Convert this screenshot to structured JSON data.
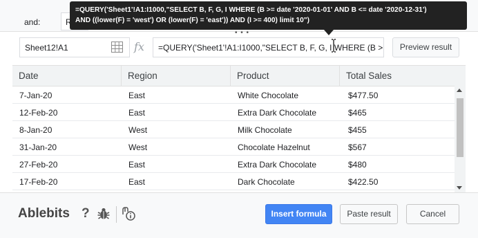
{
  "background_form": {
    "and_label": "and:",
    "field_partial": "R"
  },
  "tooltip": {
    "line1": "=QUERY('Sheet1'!A1:I1000,\"SELECT B, F, G, I WHERE (B >= date '2020-01-01' AND B <= date '2020-12-31')",
    "line2": "AND ((lower(F) = 'west') OR (lower(F) = 'east')) AND (I >= 400) limit 10\")"
  },
  "formula_bar": {
    "range": "Sheet12!A1",
    "fx_symbol": "fx",
    "formula": "=QUERY('Sheet1'!A1:I1000,\"SELECT B, F, G, I WHERE (B >",
    "preview_label": "Preview result"
  },
  "table": {
    "columns": [
      "Date",
      "Region",
      "Product",
      "Total Sales"
    ],
    "rows": [
      [
        "7-Jan-20",
        "East",
        "White Chocolate",
        "$477.50"
      ],
      [
        "12-Feb-20",
        "East",
        "Extra Dark Chocolate",
        "$465"
      ],
      [
        "8-Jan-20",
        "West",
        "Milk Chocolate",
        "$455"
      ],
      [
        "31-Jan-20",
        "West",
        "Chocolate Hazelnut",
        "$567"
      ],
      [
        "27-Feb-20",
        "East",
        "Extra Dark Chocolate",
        "$480"
      ],
      [
        "17-Feb-20",
        "East",
        "Dark Chocolate",
        "$422.50"
      ]
    ]
  },
  "footer": {
    "brand": "Ablebits",
    "help_symbol": "?",
    "insert_label": "Insert formula",
    "paste_label": "Paste result",
    "cancel_label": "Cancel"
  },
  "icons": {
    "range": "grid-icon",
    "formula": "fx-icon",
    "help": "question-icon",
    "bug": "bug-icon",
    "info": "info-icon"
  },
  "colors": {
    "primary_button": "#4285f4",
    "tooltip_bg": "#222222",
    "header_bg": "#f1f3f4"
  }
}
